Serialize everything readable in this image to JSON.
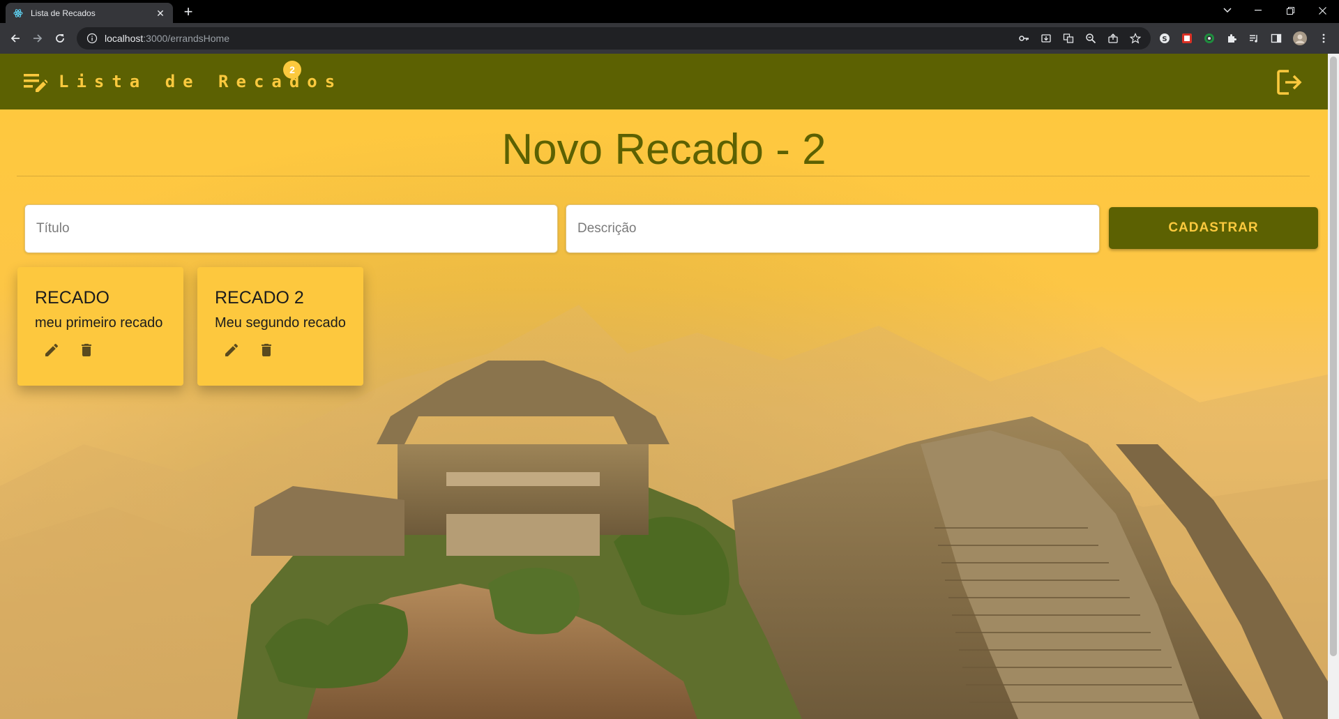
{
  "browser": {
    "tab_title": "Lista de Recados",
    "url_host": "localhost",
    "url_path": ":3000/errandsHome"
  },
  "app": {
    "brand_title": "Lista de Recados",
    "badge_count": "2",
    "page_title": "Novo Recado - 2",
    "title_placeholder": "Título",
    "description_placeholder": "Descrição",
    "submit_label": "CADASTRAR",
    "colors": {
      "header": "#5c6102",
      "accent": "#fbc93e",
      "card": "#fdc83e"
    }
  },
  "cards": [
    {
      "title": "RECADO",
      "description": "meu primeiro recado"
    },
    {
      "title": "RECADO 2",
      "description": "Meu segundo recado"
    }
  ],
  "icons": [
    "edit-note-icon",
    "logout-icon",
    "edit-icon",
    "delete-icon"
  ]
}
